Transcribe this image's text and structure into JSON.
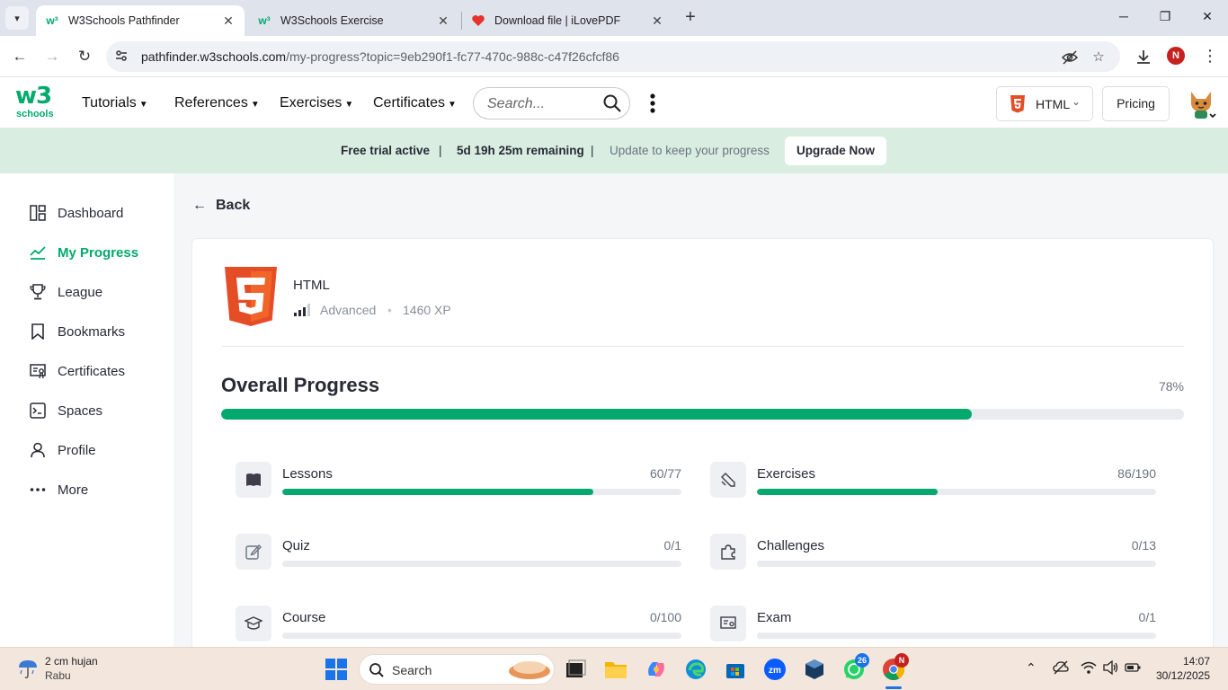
{
  "browser": {
    "tabs": [
      {
        "title": "W3Schools Pathfinder",
        "active": true,
        "favicon": "w3schools-favicon"
      },
      {
        "title": "W3Schools Exercise",
        "active": false,
        "favicon": "w3schools-favicon"
      },
      {
        "title": "Download file | iLovePDF",
        "active": false,
        "favicon": "ilovepdf-heart-favicon"
      }
    ],
    "close_glyph": "✕",
    "new_tab_glyph": "+",
    "url_host": "pathfinder.w3schools.com",
    "url_path": "/my-progress?topic=9eb290f1-fc77-470c-988c-c47f26cfcf86",
    "profile_initial": "N"
  },
  "header": {
    "logo_text": "w3",
    "logo_sup": "3",
    "logo_sub": "schools",
    "nav": [
      {
        "label": "Tutorials"
      },
      {
        "label": "References"
      },
      {
        "label": "Exercises"
      },
      {
        "label": "Certificates"
      }
    ],
    "search_placeholder": "Search...",
    "language_label": "HTML",
    "pricing_label": "Pricing"
  },
  "banner": {
    "trial": "Free trial active",
    "separator": "|",
    "remaining": "5d 19h 25m remaining",
    "hint": "Update to keep your progress",
    "upgrade": "Upgrade Now"
  },
  "sidebar": {
    "items": [
      {
        "label": "Dashboard",
        "icon": "dashboard-icon"
      },
      {
        "label": "My Progress",
        "icon": "progress-chart-icon",
        "active": true
      },
      {
        "label": "League",
        "icon": "trophy-icon"
      },
      {
        "label": "Bookmarks",
        "icon": "bookmark-icon"
      },
      {
        "label": "Certificates",
        "icon": "certificate-icon"
      },
      {
        "label": "Spaces",
        "icon": "terminal-icon"
      },
      {
        "label": "Profile",
        "icon": "user-icon"
      },
      {
        "label": "More",
        "icon": "more-dots-icon"
      }
    ]
  },
  "main": {
    "back_label": "Back",
    "course": {
      "title": "HTML",
      "level": "Advanced",
      "xp": "1460 XP",
      "separator": "•"
    },
    "overall": {
      "title": "Overall Progress",
      "percent_label": "78%",
      "percent": 78
    },
    "stats": [
      {
        "label": "Lessons",
        "count": "60/77",
        "done": 60,
        "total": 77,
        "icon": "book-icon"
      },
      {
        "label": "Exercises",
        "count": "86/190",
        "done": 86,
        "total": 190,
        "icon": "exercise-pencil-icon"
      },
      {
        "label": "Quiz",
        "count": "0/1",
        "done": 0,
        "total": 1,
        "icon": "quiz-edit-icon"
      },
      {
        "label": "Challenges",
        "count": "0/13",
        "done": 0,
        "total": 13,
        "icon": "puzzle-icon"
      },
      {
        "label": "Course",
        "count": "0/100",
        "done": 0,
        "total": 100,
        "icon": "graduation-cap-icon"
      },
      {
        "label": "Exam",
        "count": "0/1",
        "done": 0,
        "total": 1,
        "icon": "exam-certificate-icon"
      }
    ]
  },
  "taskbar": {
    "weather_temp": "2 cm hujan",
    "weather_day": "Rabu",
    "search_label": "Search",
    "whatsapp_badge": "26",
    "chrome_badge": "N",
    "time": "14:07",
    "date": "30/12/2025"
  },
  "colors": {
    "accent": "#04aa6d",
    "banner_bg": "#d9eee1",
    "html5_orange": "#e44d26"
  }
}
